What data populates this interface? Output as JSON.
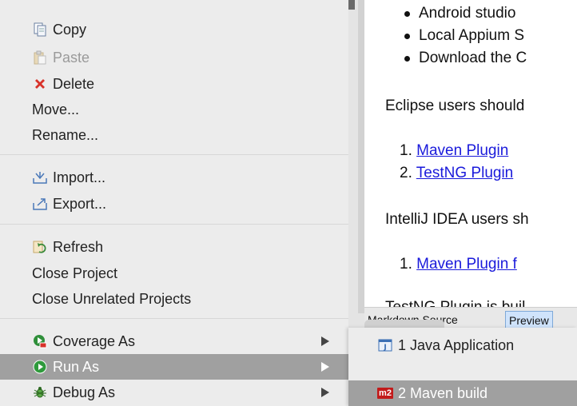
{
  "context_menu": {
    "items": [
      {
        "label": "Copy",
        "icon": "copy-icon"
      },
      {
        "label": "Paste",
        "icon": "paste-icon",
        "disabled": true
      },
      {
        "label": "Delete",
        "icon": "delete-icon"
      },
      {
        "label": "Move..."
      },
      {
        "label": "Rename..."
      },
      {
        "label": "Import...",
        "icon": "import-icon"
      },
      {
        "label": "Export...",
        "icon": "export-icon"
      },
      {
        "label": "Refresh",
        "icon": "refresh-icon"
      },
      {
        "label": "Close Project"
      },
      {
        "label": "Close Unrelated Projects"
      },
      {
        "label": "Coverage As",
        "icon": "coverage-icon",
        "submenu": true
      },
      {
        "label": "Run As",
        "icon": "run-icon",
        "submenu": true,
        "highlighted": true
      },
      {
        "label": "Debug As",
        "icon": "debug-icon",
        "submenu": true
      }
    ]
  },
  "submenu": {
    "items": [
      {
        "label": "1 Java Application",
        "icon": "java-application-icon"
      },
      {
        "label": "2 Maven build",
        "icon": "maven-icon",
        "icon_text": "m2",
        "highlighted": true
      }
    ]
  },
  "preview": {
    "bullets": [
      "Android studio",
      "Local Appium S",
      "Download the C"
    ],
    "eclipse_text": "Eclipse users should",
    "eclipse_list": [
      {
        "num": "1.",
        "link": "Maven Plugin"
      },
      {
        "num": "2.",
        "link": "TestNG Plugin"
      }
    ],
    "intellij_text": "IntelliJ IDEA users sh",
    "intellij_list": [
      {
        "num": "1.",
        "link": "Maven Plugin f"
      }
    ],
    "cut_text": "TestNG Plugin is buil"
  },
  "editor_tabs": {
    "source": "Markdown Source",
    "preview": "Preview"
  },
  "colors": {
    "highlight": "#a0a0a0",
    "link": "#1a1adb",
    "preview_tab": "#cfe3fb",
    "maven_badge": "#c21b1b"
  }
}
